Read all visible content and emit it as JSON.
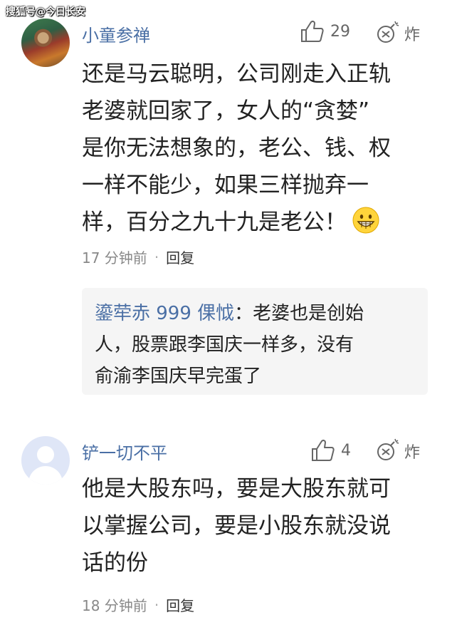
{
  "watermark": "搜狐号@今日长安",
  "comments": [
    {
      "username": "小童参禅",
      "likes": "29",
      "bomb_label": "炸",
      "lines": [
        "还是马云聪明，公司刚走入正轨",
        "老婆就回家了，女人的“贪婪”",
        "是你无法想象的，老公、钱、权",
        "一样不能少，如果三样抛弃一",
        "样，百分之九十九是老公！"
      ],
      "emoji": "grinning-face-emoji",
      "time": "17 分钟前",
      "dot": "·",
      "reply_label": "回复",
      "reply": {
        "author": "鎏荦赤 999 倮怴",
        "colon": "：",
        "lines": [
          "老婆也是创始",
          "人，股票跟李国庆一样多，没有",
          "俞渝李国庆早完蛋了"
        ]
      }
    },
    {
      "username": "铲一切不平",
      "likes": "4",
      "bomb_label": "炸",
      "lines": [
        "他是大股东吗，要是大股东就可",
        "以掌握公司，要是小股东就没说",
        "话的份"
      ],
      "time": "18 分钟前",
      "dot": "·",
      "reply_label": "回复"
    }
  ],
  "colors": {
    "username": "#4a6fa5",
    "body": "#222222",
    "meta": "#888888",
    "reply_bg": "#f5f5f5"
  }
}
